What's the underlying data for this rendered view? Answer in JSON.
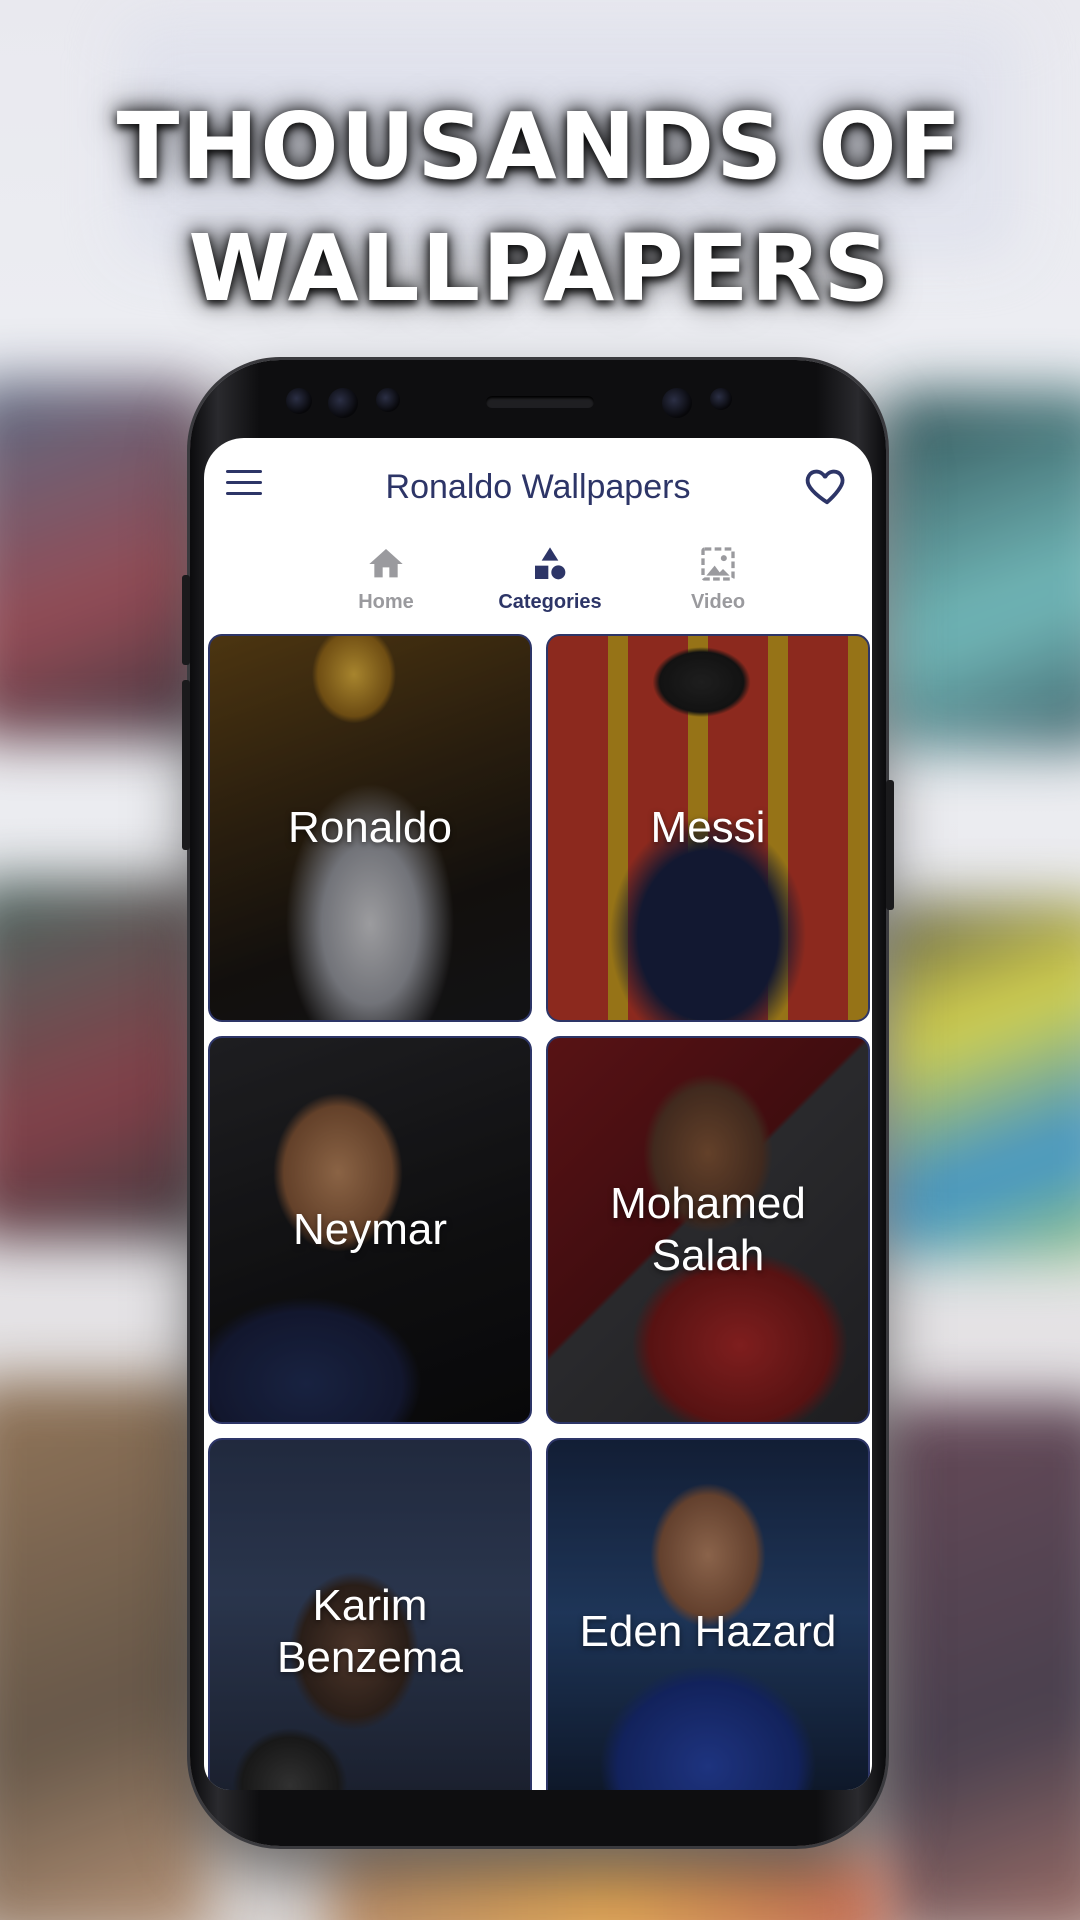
{
  "headline": {
    "line1": "THOUSANDS OF",
    "line2": "WALLPAPERS"
  },
  "app": {
    "title": "Ronaldo Wallpapers",
    "menu_icon": "hamburger-menu-icon",
    "favorite_icon": "heart-icon"
  },
  "tabs": [
    {
      "label": "Home",
      "icon": "home-icon",
      "active": false
    },
    {
      "label": "Categories",
      "icon": "categories-shapes-icon",
      "active": true
    },
    {
      "label": "Video",
      "icon": "video-image-icon",
      "active": false
    }
  ],
  "categories": [
    {
      "label": "Ronaldo"
    },
    {
      "label": "Messi"
    },
    {
      "label": "Neymar"
    },
    {
      "label": "Mohamed Salah"
    },
    {
      "label": "Karim Benzema"
    },
    {
      "label": "Eden Hazard"
    }
  ],
  "colors": {
    "accent": "#2d3567",
    "inactive_tab": "#9a9a9e",
    "screen_bg": "#ffffff"
  }
}
